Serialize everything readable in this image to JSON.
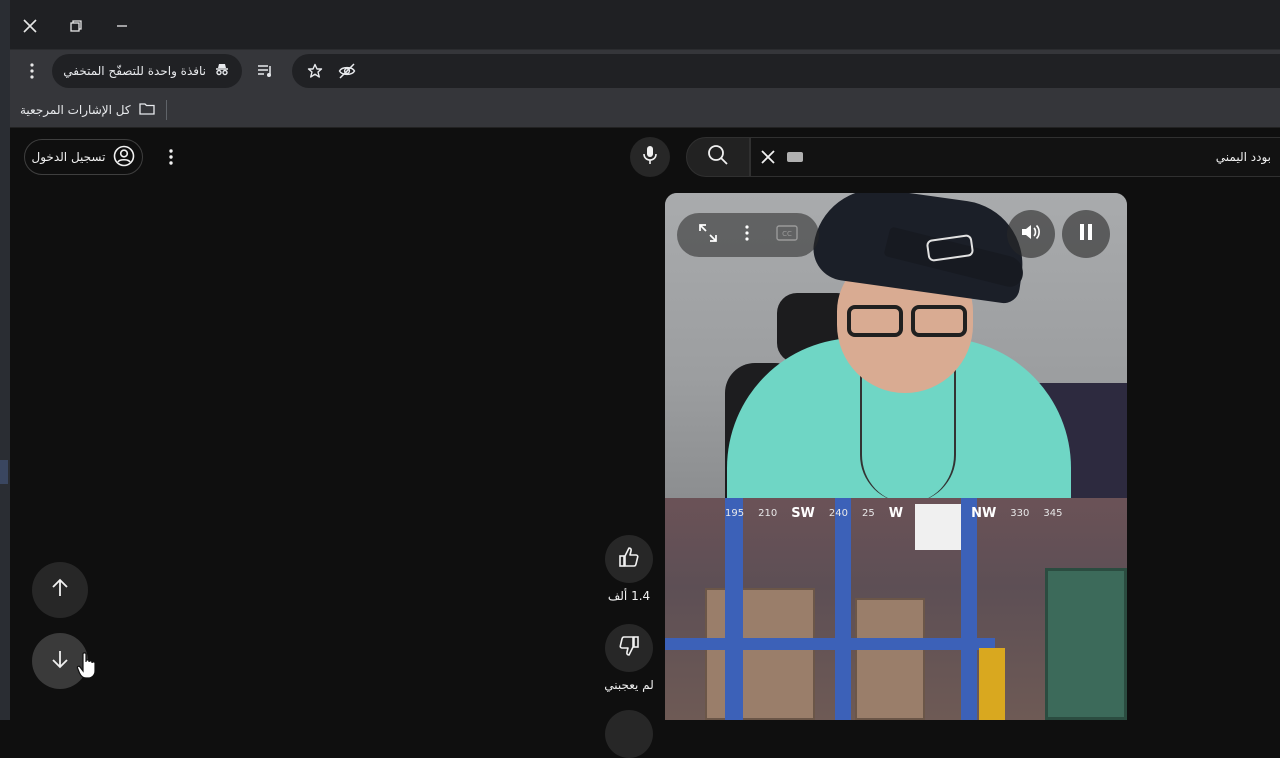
{
  "window": {
    "controls": [
      "close-icon",
      "restore-icon",
      "minimize-icon"
    ]
  },
  "toolbar": {
    "incognito_label": "نافذة واحدة للتصفّح المتخفي",
    "icons": [
      "menu-dots-icon",
      "incognito-icon",
      "reading-list-icon",
      "bookmark-star-icon",
      "eye-off-icon"
    ]
  },
  "bookmarks": {
    "all_bookmarks_label": "كل الإشارات المرجعية"
  },
  "youtube": {
    "signin_label": "تسجيل الدخول",
    "search": {
      "query": "بودد اليمني"
    },
    "actions": {
      "like_count": "1.4 ألف",
      "dislike_label": "لم يعجبني"
    }
  },
  "player": {
    "controls": [
      "fullscreen-icon",
      "more-icon",
      "captions-icon",
      "volume-icon",
      "pause-icon"
    ],
    "hud": {
      "compass": [
        "195",
        "210",
        "SW",
        "240",
        "25",
        "W",
        "NW",
        "330",
        "345"
      ]
    }
  },
  "colors": {
    "background": "#0f0f0f",
    "chrome_toolbar": "#35363a",
    "titlebar": "#1f2023",
    "button_bg": "#272727"
  }
}
